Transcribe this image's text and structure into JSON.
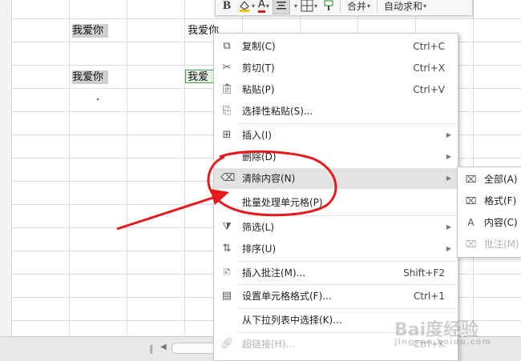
{
  "cells": {
    "a1": "我爱你",
    "b1": "我爱你",
    "a2": "我爱你",
    "b2": "我爱"
  },
  "toolbar": {
    "bold_label": "B",
    "font_color_label": "A",
    "merge_label": "合并",
    "autosum_label": "自动求和"
  },
  "menu": {
    "copy": {
      "label": "复制(C)",
      "shortcut": "Ctrl+C"
    },
    "cut": {
      "label": "剪切(T)",
      "shortcut": "Ctrl+X"
    },
    "paste": {
      "label": "粘贴(P)",
      "shortcut": "Ctrl+V"
    },
    "paste_special": {
      "label": "选择性粘贴(S)..."
    },
    "insert": {
      "label": "插入(I)"
    },
    "delete": {
      "label": "删除(D)"
    },
    "clear_contents": {
      "label": "清除内容(N)"
    },
    "batch_process": {
      "label": "批量处理单元格(P)"
    },
    "filter": {
      "label": "筛选(L)"
    },
    "sort": {
      "label": "排序(U)"
    },
    "insert_comment": {
      "label": "插入批注(M)...",
      "shortcut": "Shift+F2"
    },
    "format_cells": {
      "label": "设置单元格格式(F)...",
      "shortcut": "Ctrl+1"
    },
    "pick_from_list": {
      "label": "从下拉列表中选择(K)..."
    },
    "hyperlink": {
      "label": "超链接(H)...",
      "shortcut": "Ctrl+K"
    }
  },
  "submenu": {
    "all": "全部(A)",
    "formats": "格式(F)",
    "contents": "内容(C)",
    "comments": "批注(M)"
  },
  "watermark": {
    "text": "Bai度经验",
    "sub": "jingyan.baidu.com"
  },
  "colors": {
    "annotation": "#e8191c",
    "hover": "#e3e3e3",
    "disabled": "#b3b3b3"
  }
}
